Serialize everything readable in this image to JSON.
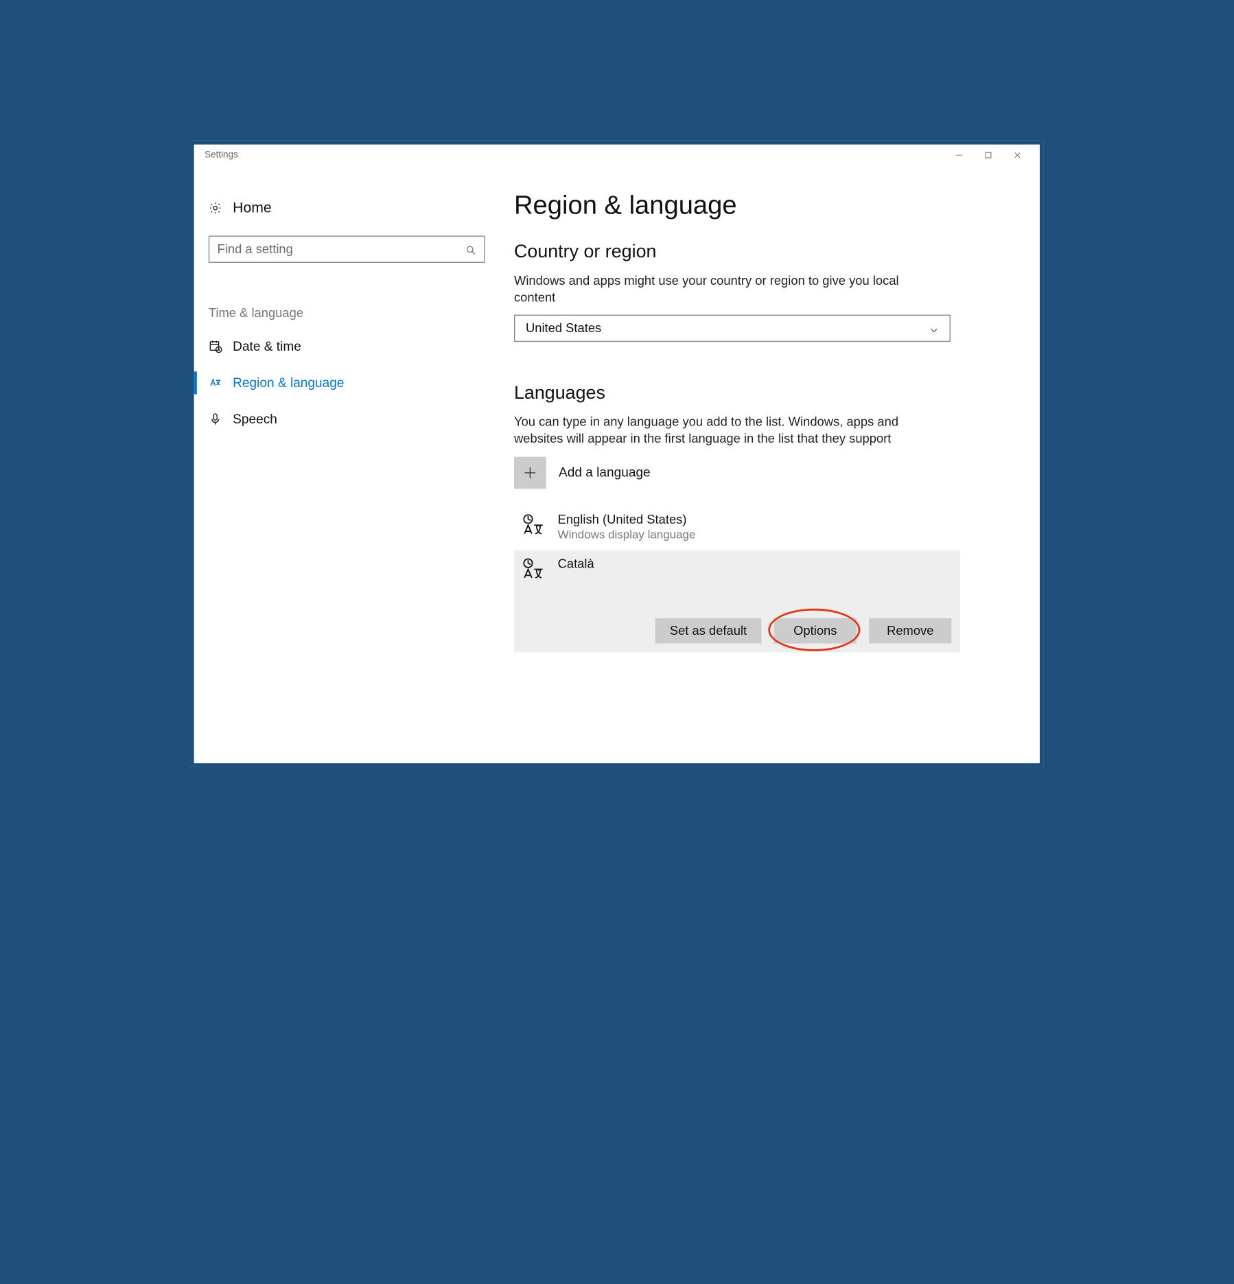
{
  "window": {
    "title": "Settings"
  },
  "sidebar": {
    "home": "Home",
    "search_placeholder": "Find a setting",
    "section": "Time & language",
    "items": [
      {
        "label": "Date & time"
      },
      {
        "label": "Region & language"
      },
      {
        "label": "Speech"
      }
    ]
  },
  "main": {
    "title": "Region & language",
    "region": {
      "heading": "Country or region",
      "desc": "Windows and apps might use your country or region to give you local content",
      "selected": "United States"
    },
    "languages": {
      "heading": "Languages",
      "desc": "You can type in any language you add to the list. Windows, apps and websites will appear in the first language in the list that they support",
      "add_label": "Add a language",
      "items": [
        {
          "name": "English (United States)",
          "sub": "Windows display language"
        },
        {
          "name": "Català",
          "sub": ""
        }
      ],
      "buttons": {
        "default": "Set as default",
        "options": "Options",
        "remove": "Remove"
      }
    }
  }
}
